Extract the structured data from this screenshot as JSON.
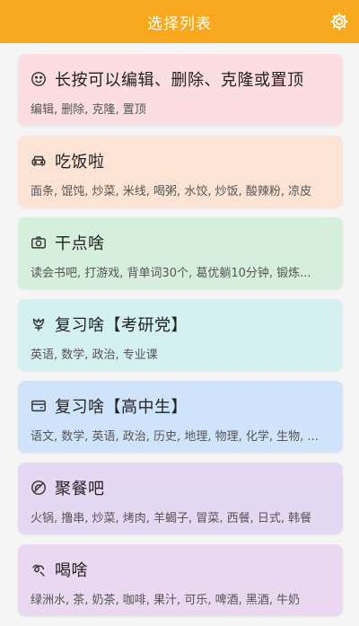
{
  "header": {
    "title": "选择列表",
    "settings_icon": "gear-icon",
    "color": "#f7a81c"
  },
  "cards": [
    {
      "icon": "smiley-icon",
      "title": "长按可以编辑、删除、克隆或置顶",
      "subtitle": "编辑, 删除, 克隆, 置顶",
      "color": "#fcdde1"
    },
    {
      "icon": "car-icon",
      "title": "吃饭啦",
      "subtitle": "面条, 馄饨, 炒菜, 米线, 喝粥, 水饺, 炒饭, 酸辣粉, 凉皮",
      "color": "#fde3d3"
    },
    {
      "icon": "camera-icon",
      "title": "干点啥",
      "subtitle": "读会书吧, 打游戏, 背单词30个, 葛优躺10分钟, 锻炼...",
      "color": "#d6efdc"
    },
    {
      "icon": "tulip-icon",
      "title": "复习啥【考研党】",
      "subtitle": "英语, 数学, 政治, 专业课",
      "color": "#d4f0f0"
    },
    {
      "icon": "wallet-icon",
      "title": "复习啥【高中生】",
      "subtitle": "语文, 数学, 英语, 政治, 历史, 地理, 物理, 化学, 生物, ...",
      "color": "#cfe3fa"
    },
    {
      "icon": "no-meat-icon",
      "title": "聚餐吧",
      "subtitle": "火锅, 撸串, 炒菜, 烤肉, 羊蝎子, 冒菜, 西餐, 日式, 韩餐",
      "color": "#e4d8f2"
    },
    {
      "icon": "noodle-icon",
      "title": "喝啥",
      "subtitle": "绿洲水, 茶, 奶茶, 咖啡, 果汁, 可乐, 啤酒, 黑酒, 牛奶",
      "color": "#ead8f0"
    }
  ]
}
